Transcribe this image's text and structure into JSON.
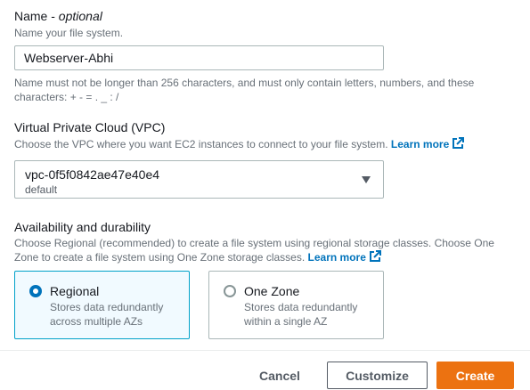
{
  "name_field": {
    "label": "Name - ",
    "optional": "optional",
    "description": "Name your file system.",
    "value": "Webserver-Abhi",
    "constraint_line1": "Name must not be longer than 256 characters, and must only contain letters, numbers, and these",
    "constraint_line2": "characters: + - = . _ : /"
  },
  "vpc_field": {
    "label": "Virtual Private Cloud (VPC)",
    "description": "Choose the VPC where you want EC2 instances to connect to your file system.",
    "learn_more": "Learn more",
    "selected_value": "vpc-0f5f0842ae47e40e4",
    "selected_sub": "default"
  },
  "availability": {
    "label": "Availability and durability",
    "description_line1": "Choose Regional (recommended) to create a file system using regional storage classes. Choose One",
    "description_line2": "Zone to create a file system using One Zone storage classes.",
    "learn_more": "Learn more",
    "options": [
      {
        "title": "Regional",
        "desc1": "Stores data redundantly",
        "desc2": "across multiple AZs",
        "selected": true
      },
      {
        "title": "One Zone",
        "desc1": "Stores data redundantly",
        "desc2": "within a single AZ",
        "selected": false
      }
    ]
  },
  "footer": {
    "cancel": "Cancel",
    "customize": "Customize",
    "create": "Create"
  },
  "colors": {
    "accent_link": "#0073bb",
    "primary_button": "#ec7211",
    "selected_tile_border": "#00a1c9",
    "selected_tile_bg": "#f1faff"
  },
  "icons": {
    "external_link": "external-link-icon",
    "dropdown": "caret-down-icon"
  }
}
